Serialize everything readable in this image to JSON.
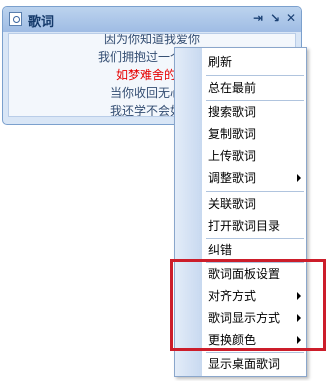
{
  "window": {
    "title": "歌词",
    "controls": [
      "pin-icon",
      "minimize-icon",
      "close-icon"
    ]
  },
  "lyrics": {
    "lines": [
      "因为你知道我爱你",
      "我们拥抱过一个春天",
      "如梦难舍的睡",
      "当你收回无心的",
      "我还学不会如何"
    ],
    "current_index": 2
  },
  "menu": {
    "items": [
      {
        "label": "刷新"
      },
      {
        "label": "总在最前"
      },
      {
        "label": "搜索歌词"
      },
      {
        "label": "复制歌词"
      },
      {
        "label": "上传歌词"
      },
      {
        "label": "调整歌词",
        "submenu": true
      },
      {
        "label": "关联歌词"
      },
      {
        "label": "打开歌词目录"
      },
      {
        "label": "纠错"
      },
      {
        "label": "歌词面板设置"
      },
      {
        "label": "对齐方式",
        "submenu": true
      },
      {
        "label": "歌词显示方式",
        "submenu": true
      },
      {
        "label": "更换颜色",
        "submenu": true
      },
      {
        "label": "显示桌面歌词"
      }
    ]
  },
  "colors": {
    "highlight": "#cc1d2a",
    "current_lyric": "#e60000",
    "titlebar": "#9fbce4"
  }
}
